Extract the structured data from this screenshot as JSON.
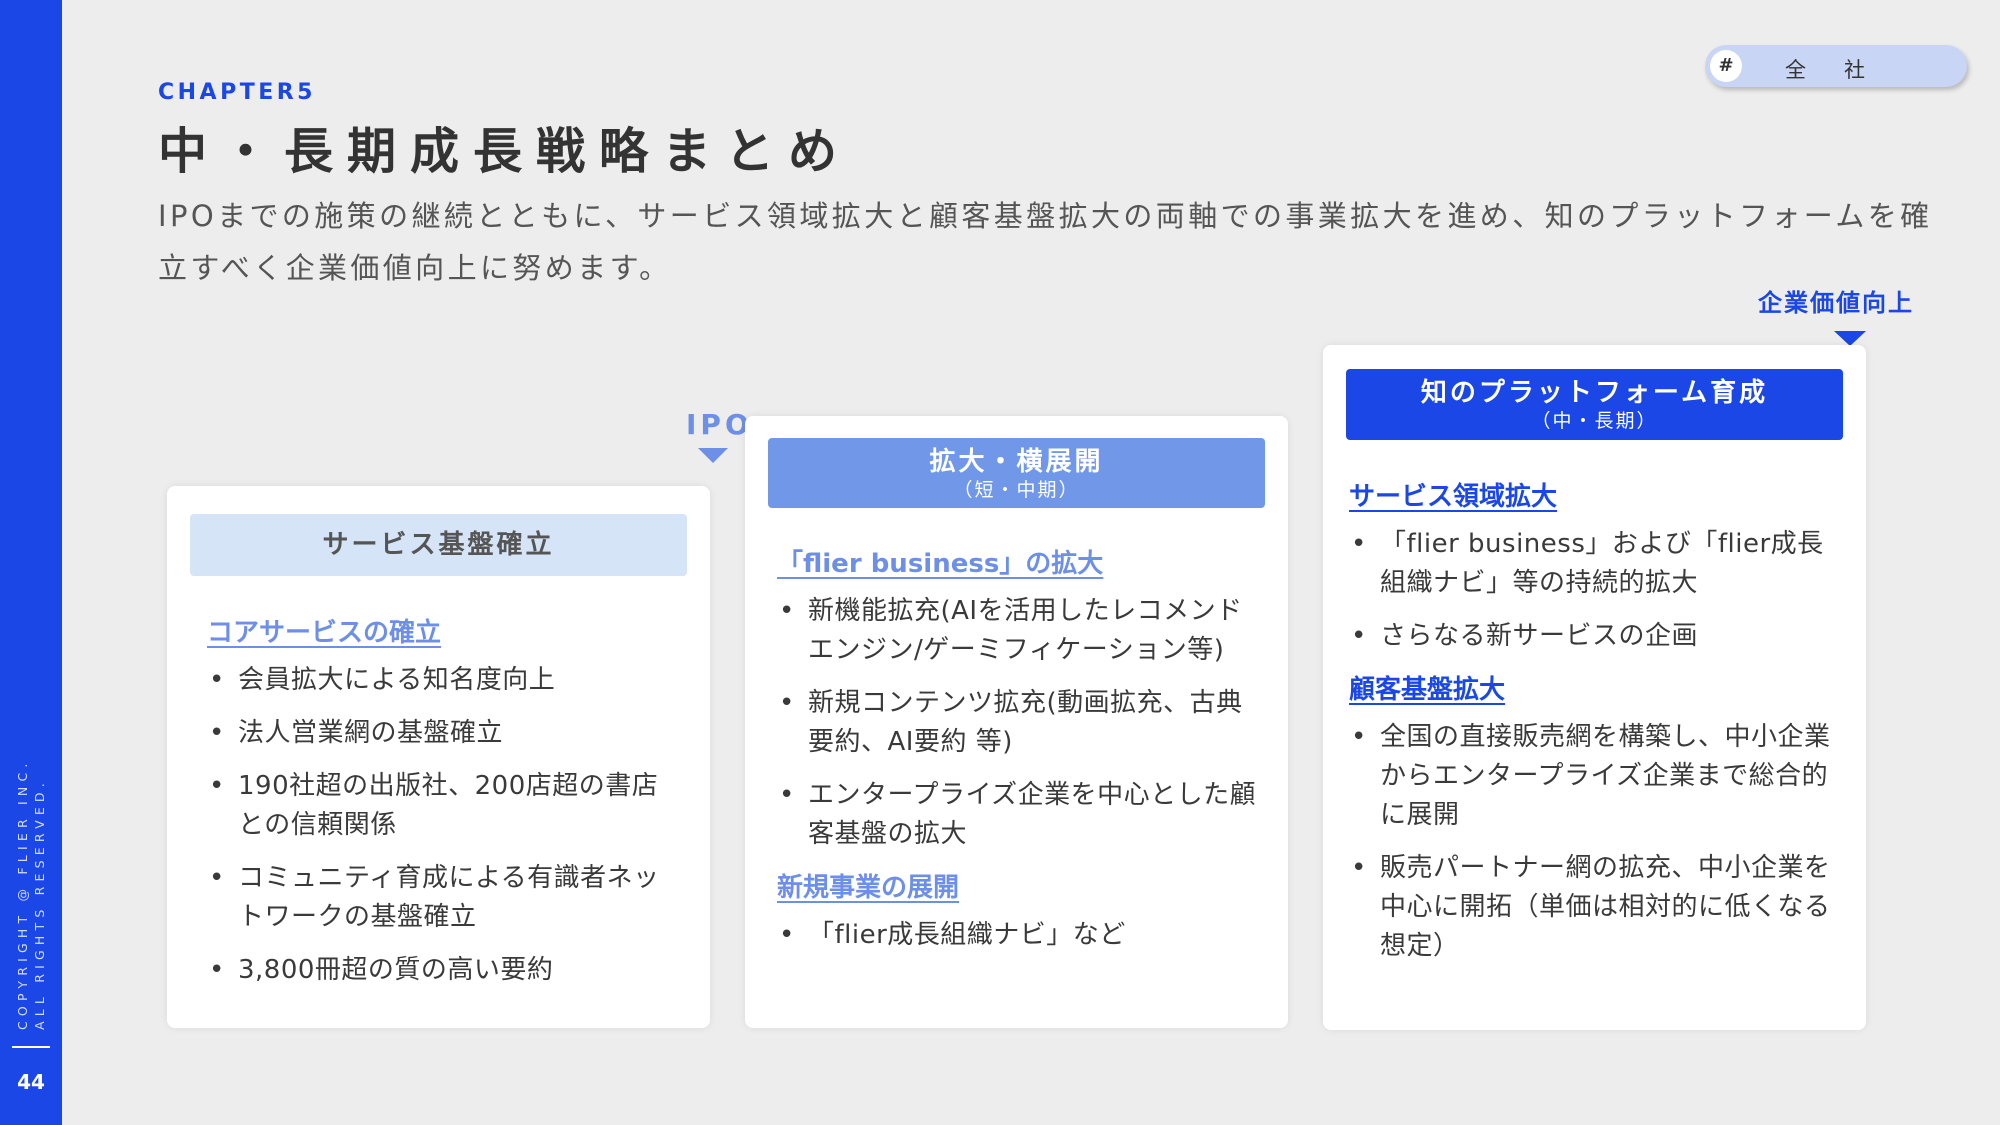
{
  "sidebar": {
    "copyright_line1": "COPYRIGHT @ FLIER INC.",
    "copyright_line2": "ALL RIGHTS RESERVED.",
    "page_number": "44"
  },
  "tag": {
    "hash": "#",
    "label": "全社"
  },
  "header": {
    "chapter": "CHAPTER5",
    "title": "中・長期成長戦略まとめ",
    "lead": "IPOまでの施策の継続とともに、サービス領域拡大と顧客基盤拡大の両軸での事業拡大を進め、知のプラットフォームを確立すべく企業価値向上に努めます。"
  },
  "markers": {
    "ipo": "IPO",
    "value_up": "企業価値向上"
  },
  "cards": [
    {
      "title": "サービス基盤確立",
      "subtitle": "",
      "sections": [
        {
          "heading": "コアサービスの確立",
          "items": [
            "会員拡大による知名度向上",
            "法人営業網の基盤確立",
            "190社超の出版社、200店超の書店との信頼関係",
            "コミュニティ育成による有識者ネットワークの基盤確立",
            "3,800冊超の質の高い要約"
          ]
        }
      ]
    },
    {
      "title": "拡大・横展開",
      "subtitle": "（短・中期）",
      "sections": [
        {
          "heading": "「flier business」の拡大",
          "items": [
            "新機能拡充(AIを活用したレコメンドエンジン/ゲーミフィケーション等)",
            "新規コンテンツ拡充(動画拡充、古典要約、AI要約 等)",
            "エンタープライズ企業を中心とした顧客基盤の拡大"
          ]
        },
        {
          "heading": "新規事業の展開",
          "items": [
            "「flier成長組織ナビ」など"
          ]
        }
      ]
    },
    {
      "title": "知のプラットフォーム育成",
      "subtitle": "（中・長期）",
      "sections": [
        {
          "heading": "サービス領域拡大",
          "items": [
            "「flier business」および「flier成長組織ナビ」等の持続的拡大",
            "さらなる新サービスの企画"
          ]
        },
        {
          "heading": "顧客基盤拡大",
          "items": [
            "全国の直接販売網を構築し、中小企業からエンタープライズ企業まで総合的に展開",
            "販売パートナー網の拡充、中小企業を中心に開拓（単価は相対的に低くなる想定）"
          ]
        }
      ]
    }
  ],
  "colors": {
    "brand_blue": "#1a47e5",
    "mid_blue": "#7198e8",
    "light_blue": "#d6e4f7",
    "background": "#ededed"
  }
}
